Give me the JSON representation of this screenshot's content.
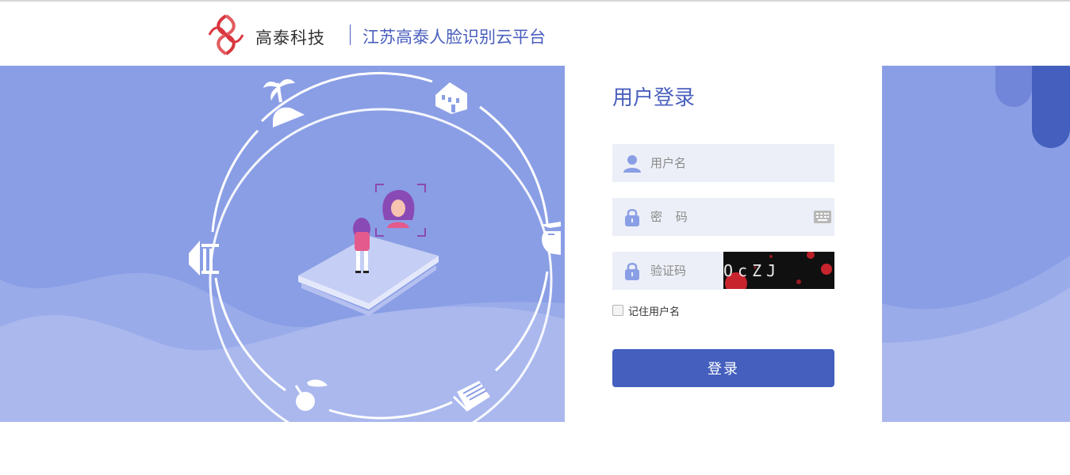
{
  "header": {
    "brand_name": "高泰科技",
    "platform_name": "江苏高泰人脸识别云平台"
  },
  "login": {
    "title": "用户登录",
    "username_placeholder": "用户名",
    "password_placeholder": "密 码",
    "captcha_placeholder": "验证码",
    "captcha_text": "OcZJ",
    "remember_label": "记住用户名",
    "remember_checked": false,
    "submit_label": "登录"
  },
  "icons": {
    "logo": "logo-icon",
    "user": "user-icon",
    "lock": "lock-icon",
    "keyboard": "keyboard-icon",
    "circle_icons": [
      "palm-tree-icon",
      "school-building-icon",
      "food-icon",
      "cherry-icon",
      "museum-icon",
      "pages-icon"
    ]
  },
  "colors": {
    "accent": "#445fbd",
    "title": "#4a5fbd",
    "banner": "#8a9ee5",
    "field_bg": "#eceff7"
  }
}
